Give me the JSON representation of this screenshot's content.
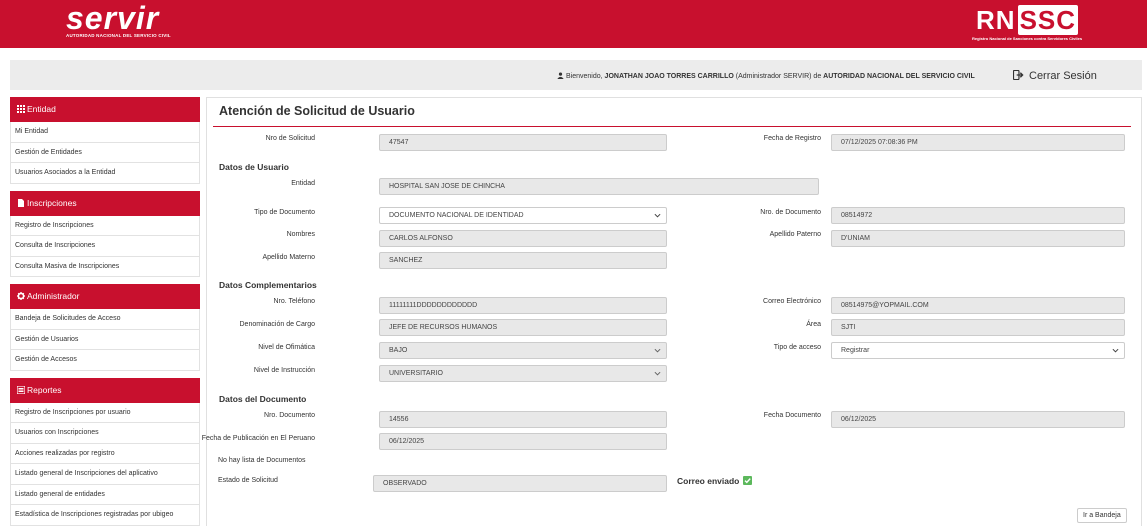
{
  "header": {
    "logo_text": "servir",
    "logo_subtitle": "AUTORIDAD NACIONAL DEL SERVICIO CIVIL",
    "rnssc_prefix": "RN",
    "rnssc_boxed": "SSC",
    "rnssc_subtitle": "Registro Nacional de Sanciones contra Servidores Civiles"
  },
  "welcome": {
    "prefix": "Bienvenido,",
    "user": "JONATHAN JOAO TORRES CARRILLO",
    "role": "(Administrador SERVIR) de",
    "org": "AUTORIDAD NACIONAL DEL SERVICIO CIVIL",
    "logout_label": "Cerrar Sesión"
  },
  "sidebar": {
    "sections": [
      {
        "title": "Entidad",
        "icon": "grid-icon",
        "items": [
          "Mi Entidad",
          "Gestión de Entidades",
          "Usuarios Asociados a la Entidad"
        ]
      },
      {
        "title": "Inscripciones",
        "icon": "file-icon",
        "items": [
          "Registro de Inscripciones",
          "Consulta de Inscripciones",
          "Consulta Masiva de Inscripciones"
        ]
      },
      {
        "title": "Administrador",
        "icon": "gear-icon",
        "items": [
          "Bandeja de Solicitudes de Acceso",
          "Gestión de Usuarios",
          "Gestión de Accesos"
        ]
      },
      {
        "title": "Reportes",
        "icon": "list-icon",
        "items": [
          "Registro de Inscripciones por usuario",
          "Usuarios con Inscripciones",
          "Acciones realizadas por registro",
          "Listado general de Inscripciones del aplicativo",
          "Listado general de entidades",
          "Estadística de Inscripciones registradas por ubigeo"
        ]
      }
    ]
  },
  "main": {
    "title": "Atención de Solicitud de Usuario",
    "nro_solicitud": {
      "label": "Nro de Solicitud",
      "value": "47547"
    },
    "fecha_registro": {
      "label": "Fecha de Registro",
      "value": "07/12/2025 07:08:36 PM"
    },
    "datos_usuario": {
      "title": "Datos de Usuario",
      "entidad": {
        "label": "Entidad",
        "value": "HOSPITAL SAN JOSE DE CHINCHA"
      },
      "tipo_documento": {
        "label": "Tipo de Documento",
        "value": "DOCUMENTO NACIONAL DE IDENTIDAD"
      },
      "nro_documento": {
        "label": "Nro. de Documento",
        "value": "08514972"
      },
      "nombres": {
        "label": "Nombres",
        "value": "CARLOS ALFONSO"
      },
      "apellido_paterno": {
        "label": "Apellido Paterno",
        "value": "D'UNIAM"
      },
      "apellido_materno": {
        "label": "Apellido Materno",
        "value": "SANCHEZ"
      }
    },
    "datos_complementarios": {
      "title": "Datos Complementarios",
      "telefono": {
        "label": "Nro. Teléfono",
        "value": "11111111DDDDDDDDDDDD"
      },
      "correo": {
        "label": "Correo Electrónico",
        "value": "08514975@YOPMAIL.COM"
      },
      "cargo": {
        "label": "Denominación de Cargo",
        "value": "JEFE DE RECURSOS HUMANOS"
      },
      "area": {
        "label": "Área",
        "value": "SJTI"
      },
      "ofimatica": {
        "label": "Nivel de Ofimática",
        "value": "BAJO"
      },
      "tipo_acceso": {
        "label": "Tipo de acceso",
        "value": "Registrar"
      },
      "instruccion": {
        "label": "Nivel de Instrucción",
        "value": "UNIVERSITARIO"
      }
    },
    "datos_documento": {
      "title": "Datos del Documento",
      "nro_documento": {
        "label": "Nro. Documento",
        "value": "14556"
      },
      "fecha_documento": {
        "label": "Fecha Documento",
        "value": "06/12/2025"
      },
      "fecha_publicacion": {
        "label": "Fecha de Publicación en El Peruano",
        "value": "06/12/2025"
      },
      "no_documentos": "No hay lista de Documentos"
    },
    "estado": {
      "label": "Estado de Solicitud",
      "value": "OBSERVADO"
    },
    "correo_enviado": "Correo enviado",
    "ir_bandeja": "Ir a Bandeja"
  },
  "colors": {
    "brand": "#c8102e",
    "success": "#5cb85c"
  }
}
